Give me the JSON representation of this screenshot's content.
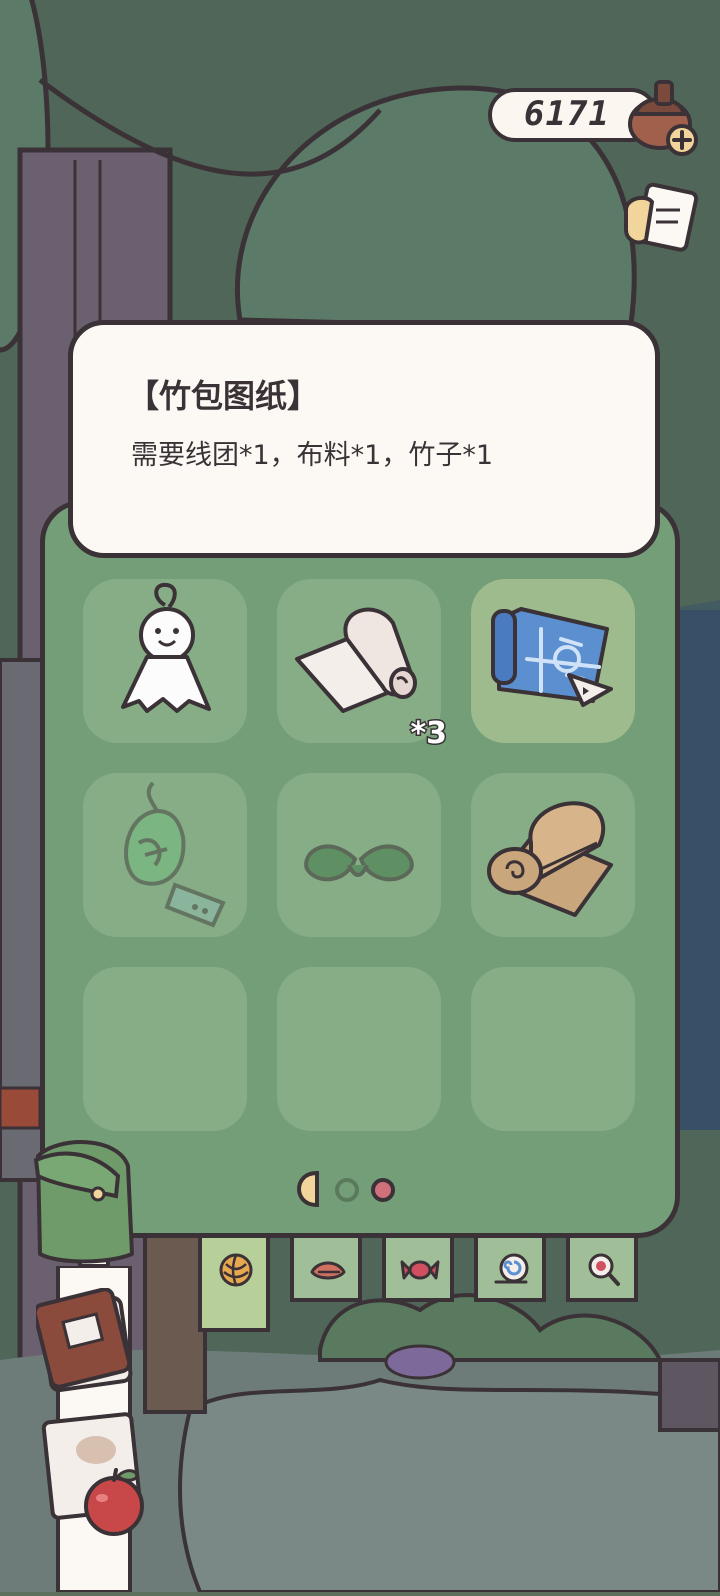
{
  "currency": {
    "value": "6171",
    "icon": "acorn-icon"
  },
  "tooltip": {
    "title": "【竹包图纸】",
    "description": "需要线团*1，布料*1，竹子*1"
  },
  "inventory": {
    "slots": [
      {
        "item": "teru-teru-bozu-icon"
      },
      {
        "item": "cloth-roll-icon",
        "count": "*3"
      },
      {
        "item": "blueprint-icon",
        "selected": true
      },
      {
        "item": "wind-chime-icon",
        "dimmed": true
      },
      {
        "item": "leaf-sprout-icon",
        "dimmed": true
      },
      {
        "item": "bamboo-mat-icon"
      },
      {
        "item": "empty"
      },
      {
        "item": "empty"
      },
      {
        "item": "empty"
      }
    ],
    "pagination": {
      "pages": 3,
      "current": 1
    }
  },
  "tabs": [
    {
      "icon": "yarn-ball-icon",
      "active": true
    },
    {
      "icon": "leaf-icon"
    },
    {
      "icon": "candy-icon"
    },
    {
      "icon": "snail-shell-icon"
    },
    {
      "icon": "magnifier-icon"
    }
  ],
  "colors": {
    "panel": "#739e78",
    "slot": "#86ad86",
    "outline": "#3a3236",
    "card": "#fcf9f4"
  }
}
